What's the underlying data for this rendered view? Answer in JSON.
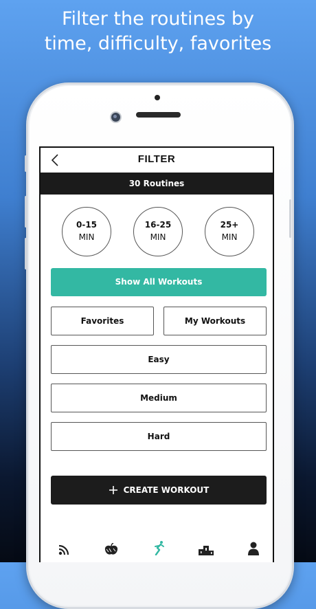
{
  "headline": {
    "line1": "Filter the routines by",
    "line2": "time, difficulty, favorites"
  },
  "screen": {
    "nav": {
      "back_icon": "chevron-left-icon",
      "title": "FILTER"
    },
    "count_bar": {
      "text": "30 Routines"
    },
    "time_filters": [
      {
        "value": "0-15",
        "unit": "MIN"
      },
      {
        "value": "16-25",
        "unit": "MIN"
      },
      {
        "value": "25+",
        "unit": "MIN"
      }
    ],
    "show_all_label": "Show All Workouts",
    "favorites_label": "Favorites",
    "my_workouts_label": "My Workouts",
    "difficulty": [
      "Easy",
      "Medium",
      "Hard"
    ],
    "create_workout": {
      "icon": "plus-icon",
      "label": "CREATE WORKOUT"
    },
    "tab_bar": [
      {
        "icon": "feed-icon"
      },
      {
        "icon": "nutrition-apple-icon"
      },
      {
        "icon": "workout-figure-icon",
        "active": true
      },
      {
        "icon": "leaderboard-podium-icon"
      },
      {
        "icon": "profile-icon"
      }
    ]
  },
  "colors": {
    "accent_teal": "#33b8a3",
    "dark_bar": "#1b1b1b",
    "background_top": "#5ea2f0",
    "background_bottom": "#050a14"
  }
}
